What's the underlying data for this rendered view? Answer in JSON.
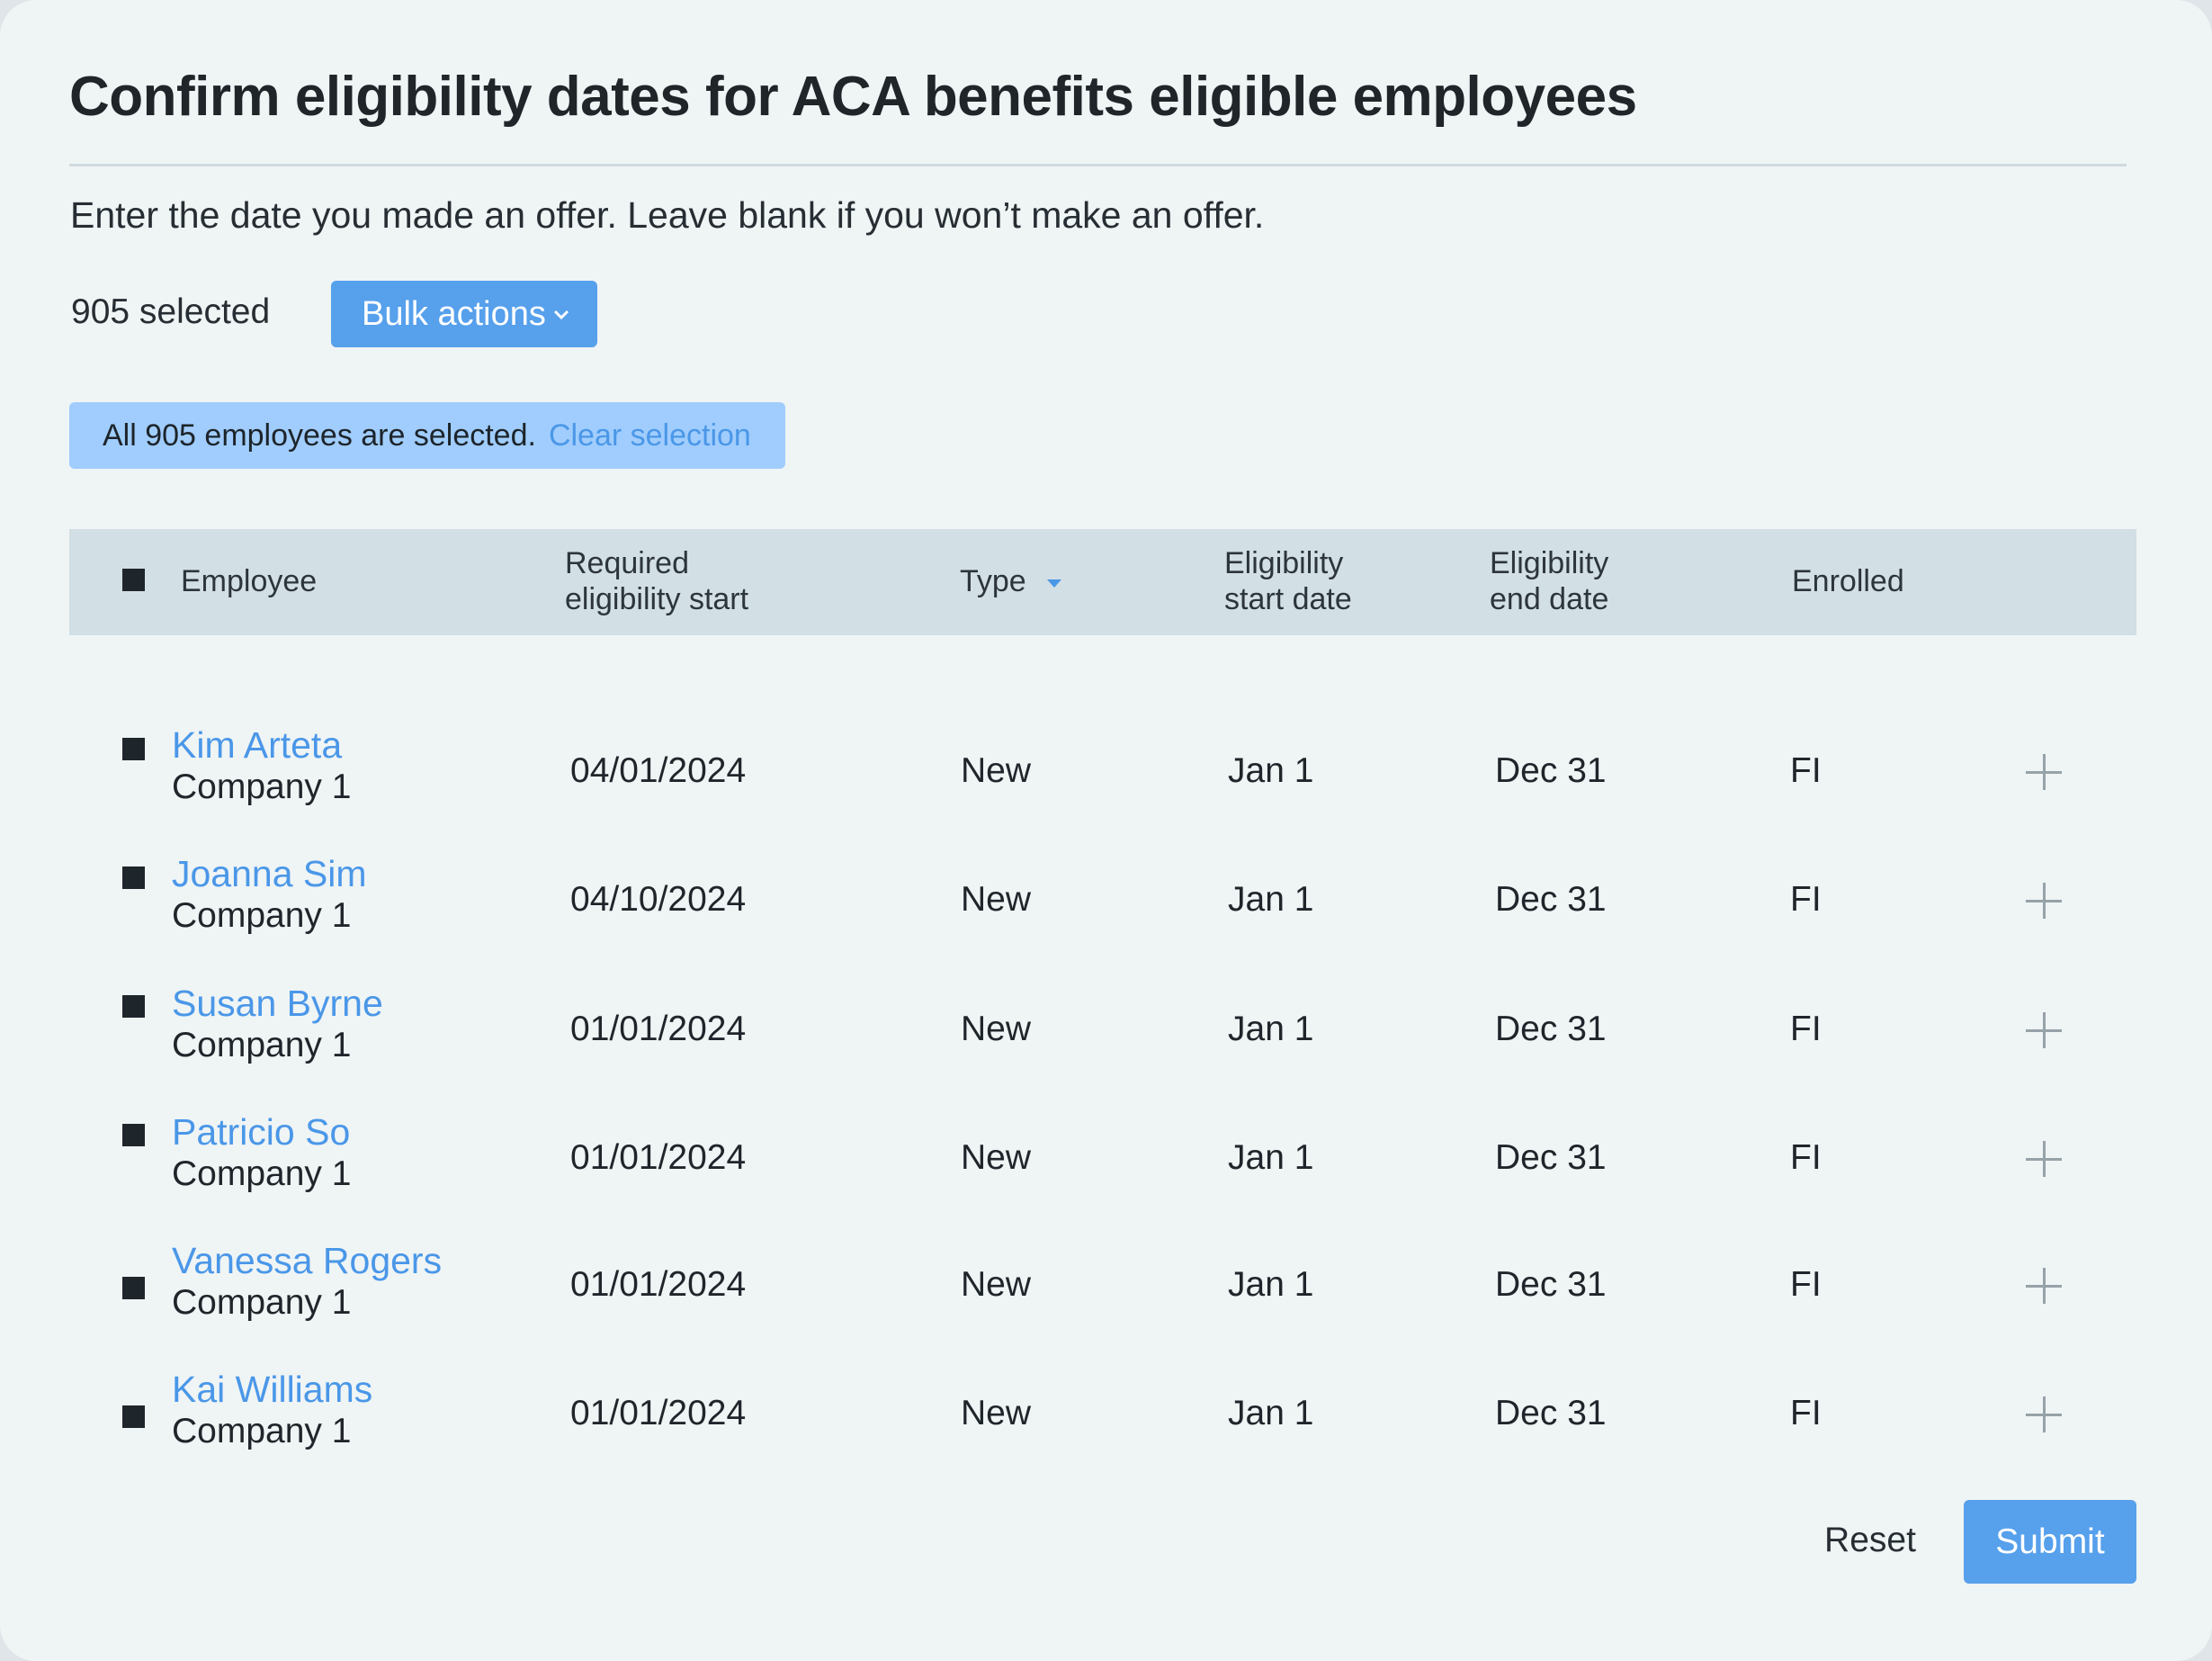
{
  "page": {
    "title": "Confirm eligibility dates for ACA benefits eligible employees",
    "subtitle": "Enter the date you made an offer. Leave blank if you won’t make an offer."
  },
  "selection": {
    "count_label": "905 selected",
    "bulk_actions_label": "Bulk actions",
    "banner_text": "All 905 employees are selected.",
    "clear_label": "Clear selection"
  },
  "table": {
    "headers": {
      "employee": "Employee",
      "required_start_line1": "Required",
      "required_start_line2": "eligibility start",
      "type": "Type",
      "elig_start_line1": "Eligibility",
      "elig_start_line2": "start date",
      "elig_end_line1": "Eligibility",
      "elig_end_line2": "end date",
      "enrolled": "Enrolled"
    },
    "rows": [
      {
        "name": "Kim Arteta",
        "company": "Company 1",
        "required_start": "04/01/2024",
        "type": "New",
        "start": "Jan 1",
        "end": "Dec 31",
        "enrolled": "FI"
      },
      {
        "name": "Joanna Sim",
        "company": "Company 1",
        "required_start": "04/10/2024",
        "type": "New",
        "start": "Jan 1",
        "end": "Dec 31",
        "enrolled": "FI"
      },
      {
        "name": "Susan Byrne",
        "company": "Company 1",
        "required_start": "01/01/2024",
        "type": "New",
        "start": "Jan 1",
        "end": "Dec 31",
        "enrolled": "FI"
      },
      {
        "name": "Patricio So",
        "company": "Company 1",
        "required_start": "01/01/2024",
        "type": "New",
        "start": "Jan 1",
        "end": "Dec 31",
        "enrolled": "FI"
      },
      {
        "name": "Vanessa Rogers",
        "company": "Company 1",
        "required_start": "01/01/2024",
        "type": "New",
        "start": "Jan 1",
        "end": "Dec 31",
        "enrolled": "FI"
      },
      {
        "name": "Kai Williams",
        "company": "Company 1",
        "required_start": "01/01/2024",
        "type": "New",
        "start": "Jan 1",
        "end": "Dec 31",
        "enrolled": "FI"
      }
    ]
  },
  "footer": {
    "reset_label": "Reset",
    "submit_label": "Submit"
  },
  "colors": {
    "accent": "#56a0ec",
    "link": "#4a97e8",
    "banner": "#a0cdfd",
    "header_bg": "#d2dfe4",
    "card_bg": "#eff4f5"
  },
  "icons": {
    "row_checkbox": "checkbox-checked-icon",
    "header_checkbox": "select-all-checkbox-icon",
    "bulk_chevron": "chevron-down-icon",
    "type_sort": "sort-caret-down-icon",
    "row_action": "plus-icon"
  }
}
